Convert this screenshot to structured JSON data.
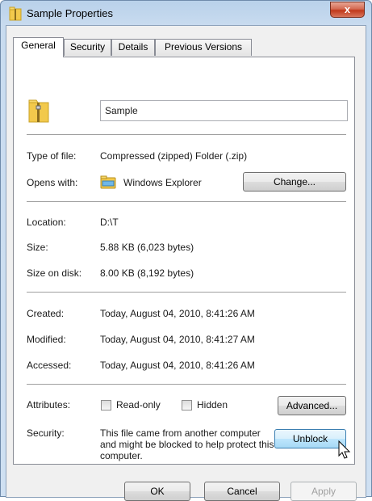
{
  "window": {
    "title": "Sample Properties",
    "close_glyph": "x"
  },
  "tabs": [
    {
      "label": "General",
      "active": true
    },
    {
      "label": "Security",
      "active": false
    },
    {
      "label": "Details",
      "active": false
    },
    {
      "label": "Previous Versions",
      "active": false
    }
  ],
  "general": {
    "file_name": "Sample",
    "type_label": "Type of file:",
    "type_value": "Compressed (zipped) Folder (.zip)",
    "opens_label": "Opens with:",
    "opens_value": "Windows Explorer",
    "change_button": "Change...",
    "location_label": "Location:",
    "location_value": "D:\\T",
    "size_label": "Size:",
    "size_value": "5.88 KB (6,023 bytes)",
    "size_disk_label": "Size on disk:",
    "size_disk_value": "8.00 KB (8,192 bytes)",
    "created_label": "Created:",
    "created_value": "Today, August 04, 2010, 8:41:26 AM",
    "modified_label": "Modified:",
    "modified_value": "Today, August 04, 2010, 8:41:27 AM",
    "accessed_label": "Accessed:",
    "accessed_value": "Today, August 04, 2010, 8:41:26 AM",
    "attributes_label": "Attributes:",
    "readonly_label": "Read-only",
    "hidden_label": "Hidden",
    "advanced_button": "Advanced...",
    "security_label": "Security:",
    "security_text": "This file came from another computer and might be blocked to help protect this computer.",
    "unblock_button": "Unblock"
  },
  "footer": {
    "ok": "OK",
    "cancel": "Cancel",
    "apply": "Apply"
  },
  "colors": {
    "title_bar": "#b9d1ea",
    "close_red": "#c0391b",
    "folder_yellow": "#f2c94c",
    "focus_blue": "#3c7fb1"
  }
}
